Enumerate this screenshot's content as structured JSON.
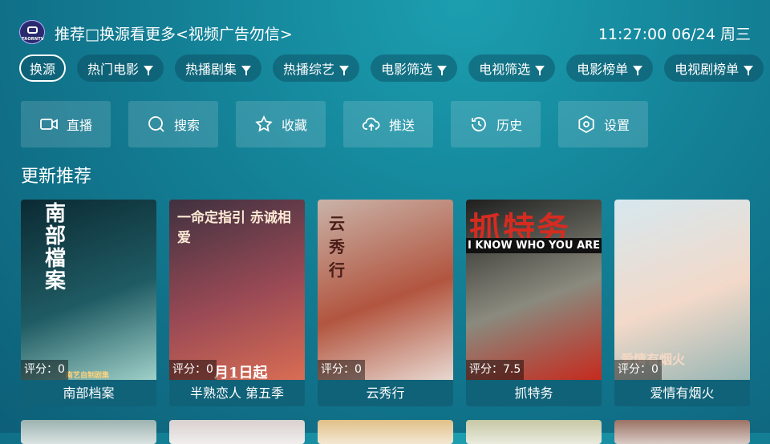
{
  "header": {
    "logo_text": "TAORNTV",
    "title": "推荐□换源看更多<视频广告勿信>",
    "clock": "11:27:00 06/24 周三"
  },
  "chips": [
    {
      "label": "换源",
      "filter": false,
      "active": true
    },
    {
      "label": "热门电影",
      "filter": true
    },
    {
      "label": "热播剧集",
      "filter": true
    },
    {
      "label": "热播综艺",
      "filter": true
    },
    {
      "label": "电影筛选",
      "filter": true
    },
    {
      "label": "电视筛选",
      "filter": true
    },
    {
      "label": "电影榜单",
      "filter": true
    },
    {
      "label": "电视剧榜单",
      "filter": true
    }
  ],
  "functions": [
    {
      "label": "直播",
      "icon": "camera-icon"
    },
    {
      "label": "搜索",
      "icon": "search-icon"
    },
    {
      "label": "收藏",
      "icon": "star-icon"
    },
    {
      "label": "推送",
      "icon": "cloud-upload-icon"
    },
    {
      "label": "历史",
      "icon": "history-icon"
    },
    {
      "label": "设置",
      "icon": "settings-icon"
    }
  ],
  "section_title": "更新推荐",
  "score_prefix": "评分：",
  "cards": [
    {
      "title": "南部档案",
      "score": "0",
      "poster_text": "南部檔案",
      "poster_sub": "南艺自制剧集",
      "colors": [
        "#0b2a33",
        "#1f5b63",
        "#9fd0c8"
      ]
    },
    {
      "title": "半熟恋人 第五季",
      "score": "0",
      "poster_text": "一命定指引 赤诚相爱",
      "poster_sub": "月1日起",
      "colors": [
        "#3f3140",
        "#9a4a55",
        "#d96d54"
      ]
    },
    {
      "title": "云秀行",
      "score": "0",
      "poster_text": "云秀行",
      "poster_sub": "",
      "colors": [
        "#c9b3a8",
        "#b2553f",
        "#e8d8d0"
      ]
    },
    {
      "title": "抓特务",
      "score": "7.5",
      "poster_text": "抓特务",
      "poster_sub": "I KNOW WHO YOU ARE",
      "colors": [
        "#1f1f1f",
        "#8a8a7e",
        "#c62a1e"
      ]
    },
    {
      "title": "爱情有烟火",
      "score": "0",
      "poster_text": "爱情有烟火",
      "poster_sub": "",
      "colors": [
        "#d6e8ef",
        "#f2d9c9",
        "#97b6b4"
      ]
    }
  ],
  "bottom_row_colors": [
    "#9cb3b0",
    "#d9d1cf",
    "#e0c089",
    "#c6c8a5",
    "#9a7264"
  ]
}
